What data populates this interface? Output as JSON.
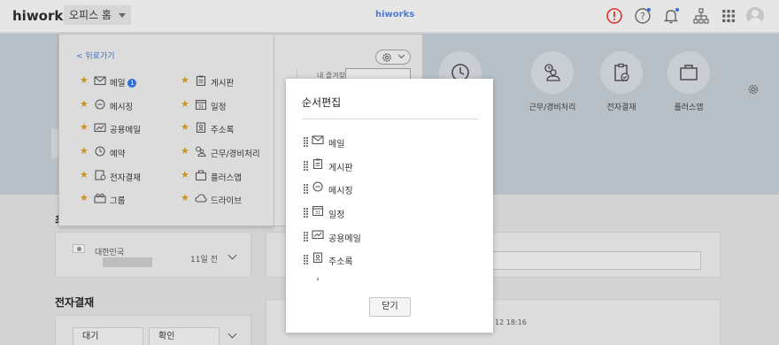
{
  "header": {
    "logo": "hiworks",
    "office_select": "오피스 홈",
    "center_logo": "hiworks",
    "colors": {
      "alert": "#d9342b",
      "notify_dot": "#2f6fd6"
    }
  },
  "hero": {
    "items": [
      {
        "label": "",
        "icon": "clock-icon"
      },
      {
        "label": "근무/경비처리",
        "icon": "person-clock-icon"
      },
      {
        "label": "전자결재",
        "icon": "clipboard-check-icon"
      },
      {
        "label": "플러스앱",
        "icon": "bag-icon"
      }
    ]
  },
  "favorites_panel": {
    "back_label": "< 뒤로가기",
    "my_favorites_label": "내 즐겨찾",
    "left_column": [
      {
        "label": "메일",
        "icon": "mail-icon",
        "badge": "1"
      },
      {
        "label": "메시징",
        "icon": "chat-icon"
      },
      {
        "label": "공용메일",
        "icon": "shared-mail-icon"
      },
      {
        "label": "예약",
        "icon": "clock-icon"
      },
      {
        "label": "전자결재",
        "icon": "approval-icon"
      },
      {
        "label": "그룹",
        "icon": "group-icon"
      }
    ],
    "right_column": [
      {
        "label": "게시판",
        "icon": "board-icon"
      },
      {
        "label": "일정",
        "icon": "calendar-icon"
      },
      {
        "label": "주소록",
        "icon": "address-book-icon"
      },
      {
        "label": "근무/경비처리",
        "icon": "person-clock-icon"
      },
      {
        "label": "플러스앱",
        "icon": "bag-icon"
      },
      {
        "label": "드라이브",
        "icon": "cloud-icon"
      }
    ]
  },
  "modal": {
    "title": "순서편집",
    "items": [
      {
        "label": "메일",
        "icon": "mail-icon"
      },
      {
        "label": "게시판",
        "icon": "board-icon"
      },
      {
        "label": "메시징",
        "icon": "chat-icon"
      },
      {
        "label": "일정",
        "icon": "calendar-icon"
      },
      {
        "label": "공용메일",
        "icon": "shared-mail-icon"
      },
      {
        "label": "주소록",
        "icon": "address-book-icon"
      }
    ],
    "close_label": "닫기"
  },
  "lower": {
    "section1_title_partial": "최",
    "country": "대한민국",
    "time_ago": "11일 전",
    "approval_title": "전자결재",
    "tab_waiting": "대기",
    "tab_confirm": "확인",
    "timestamp_partial": "12 18:16"
  }
}
